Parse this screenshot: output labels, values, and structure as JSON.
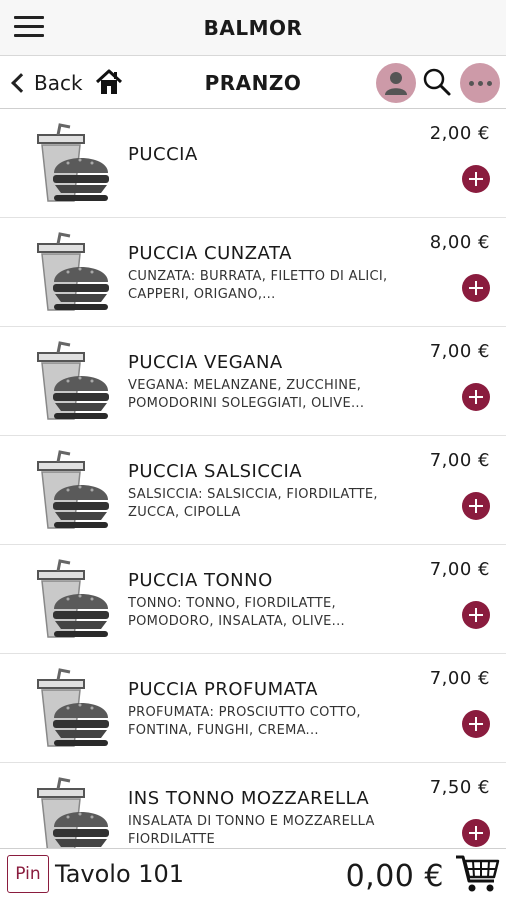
{
  "header": {
    "title": "BALMOR"
  },
  "nav": {
    "back_label": "Back",
    "section_title": "PRANZO"
  },
  "items": [
    {
      "name": "PUCCIA",
      "desc": "",
      "price": "2,00 €"
    },
    {
      "name": "PUCCIA CUNZATA",
      "desc": "CUNZATA: BURRATA, FILETTO DI ALICI, CAPPERI, ORIGANO,...",
      "price": "8,00 €"
    },
    {
      "name": "PUCCIA VEGANA",
      "desc": "VEGANA: MELANZANE, ZUCCHINE, POMODORINI SOLEGGIATI, OLIVE...",
      "price": "7,00 €"
    },
    {
      "name": "PUCCIA SALSICCIA",
      "desc": "SALSICCIA: SALSICCIA, FIORDILATTE, ZUCCA, CIPOLLA",
      "price": "7,00 €"
    },
    {
      "name": "PUCCIA TONNO",
      "desc": "TONNO: TONNO, FIORDILATTE, POMODORO, INSALATA, OLIVE...",
      "price": "7,00 €"
    },
    {
      "name": "PUCCIA PROFUMATA",
      "desc": "PROFUMATA: PROSCIUTTO COTTO, FONTINA, FUNGHI, CREMA...",
      "price": "7,00 €"
    },
    {
      "name": "INS TONNO MOZZARELLA",
      "desc": "INSALATA DI TONNO E MOZZARELLA FIORDILATTE",
      "price": "7,50 €"
    }
  ],
  "footer": {
    "pin_label": "Pin",
    "table_label": "Tavolo 101",
    "total": "0,00 €"
  },
  "icons": {
    "menu": "hamburger-menu-icon",
    "home": "home-icon",
    "user": "user-icon",
    "search": "search-icon",
    "more": "more-icon",
    "add": "plus-icon",
    "cart": "cart-icon",
    "thumb": "burger-drink-icon"
  },
  "colors": {
    "accent": "#8a1c3e",
    "round_button": "#cd9aa8"
  }
}
